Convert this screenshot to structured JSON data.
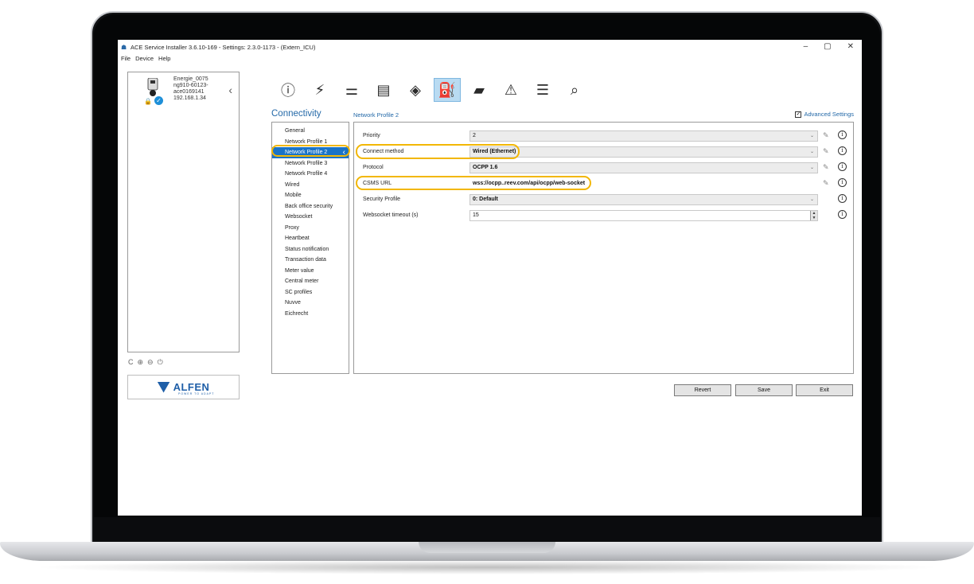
{
  "window": {
    "title": "ACE Service Installer 3.6.10-169 - Settings: 2.3.0-1173 - (Extern_ICU)",
    "minimize": "–",
    "maximize": "▢",
    "close": "✕"
  },
  "menu": [
    "File",
    "Device",
    "Help"
  ],
  "device": {
    "name": "Energie_0075",
    "serial": "ng910-60123-ace0169141",
    "ip": "192.168.1.34"
  },
  "bottom_icons": [
    "C",
    "⊕",
    "⊖",
    "⏻"
  ],
  "brand": {
    "name": "ALFEN",
    "tagline": "POWER TO ADAPT"
  },
  "toolbar": {
    "icons": [
      "info-icon",
      "pylon-icon",
      "grid-icon",
      "card-reader-icon",
      "rfid-tag-icon",
      "charging-station-icon",
      "chart-icon",
      "warning-icon",
      "log-icon",
      "diagnostics-icon"
    ]
  },
  "section_title": "Connectivity",
  "sub_title": "Network Profile 2",
  "advanced_settings": {
    "label": "Advanced Settings",
    "checked": true
  },
  "nav": [
    "General",
    "Network Profile 1",
    "Network Profile 2",
    "Network Profile 3",
    "Network Profile 4",
    "Wired",
    "Mobile",
    "Back office security",
    "Websocket",
    "Proxy",
    "Heartbeat",
    "Status notification",
    "Transaction data",
    "Meter value",
    "Central meter",
    "SC profiles",
    "Nuvve",
    "Eichrecht"
  ],
  "nav_selected": "Network Profile 2",
  "form": {
    "priority": {
      "label": "Priority",
      "value": "2"
    },
    "connect_method": {
      "label": "Connect method",
      "value": "Wired (Ethernet)"
    },
    "protocol": {
      "label": "Protocol",
      "value": "OCPP 1.6"
    },
    "csms_url": {
      "label": "CSMS URL",
      "value": "wss://ocpp..reev.com/api/ocpp/web-socket"
    },
    "security_profile": {
      "label": "Security Profile",
      "value": "0: Default"
    },
    "websocket_timeout": {
      "label": "Websocket timeout (s)",
      "value": "15"
    }
  },
  "buttons": {
    "revert": "Revert",
    "save": "Save",
    "exit": "Exit"
  },
  "colors": {
    "accent": "#2469a8",
    "selection": "#1a73c7",
    "highlight": "#f2b705"
  }
}
